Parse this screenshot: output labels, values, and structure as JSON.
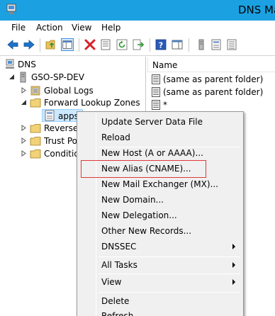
{
  "window": {
    "title": "DNS Ma",
    "accent": "#1ba1e2"
  },
  "menubar": {
    "items": [
      "File",
      "Action",
      "View",
      "Help"
    ]
  },
  "toolbar": {
    "buttons": [
      "back-icon",
      "forward-icon",
      "up-folder-icon",
      "show-hide-tree-icon",
      "delete-icon",
      "properties-icon",
      "refresh-icon",
      "export-icon",
      "help-icon",
      "action-pane-icon",
      "server-icon",
      "zone-icon",
      "record-icon"
    ]
  },
  "tree": {
    "root": "DNS",
    "server": "GSO-SP-DEV",
    "nodes": [
      "Global Logs",
      "Forward Lookup Zones",
      "apps",
      "Reverse",
      "Trust Po",
      "Conditio"
    ]
  },
  "list": {
    "column_header": "Name",
    "rows": [
      "(same as parent folder)",
      "(same as parent folder)",
      "*"
    ]
  },
  "context_menu": {
    "items": [
      {
        "label": "Update Server Data File",
        "submenu": false
      },
      {
        "label": "Reload",
        "submenu": false
      },
      {
        "label": "New Host (A or AAAA)...",
        "submenu": false
      },
      {
        "label": "New Alias (CNAME)...",
        "submenu": false,
        "highlighted": true
      },
      {
        "label": "New Mail Exchanger (MX)...",
        "submenu": false
      },
      {
        "label": "New Domain...",
        "submenu": false
      },
      {
        "label": "New Delegation...",
        "submenu": false
      },
      {
        "label": "Other New Records...",
        "submenu": false
      },
      {
        "label": "DNSSEC",
        "submenu": true
      },
      {
        "label": "All Tasks",
        "submenu": true
      },
      {
        "label": "View",
        "submenu": true
      },
      {
        "label": "Delete",
        "submenu": false
      },
      {
        "label": "Refresh",
        "submenu": false
      }
    ],
    "highlight_color": "#e0383a"
  }
}
